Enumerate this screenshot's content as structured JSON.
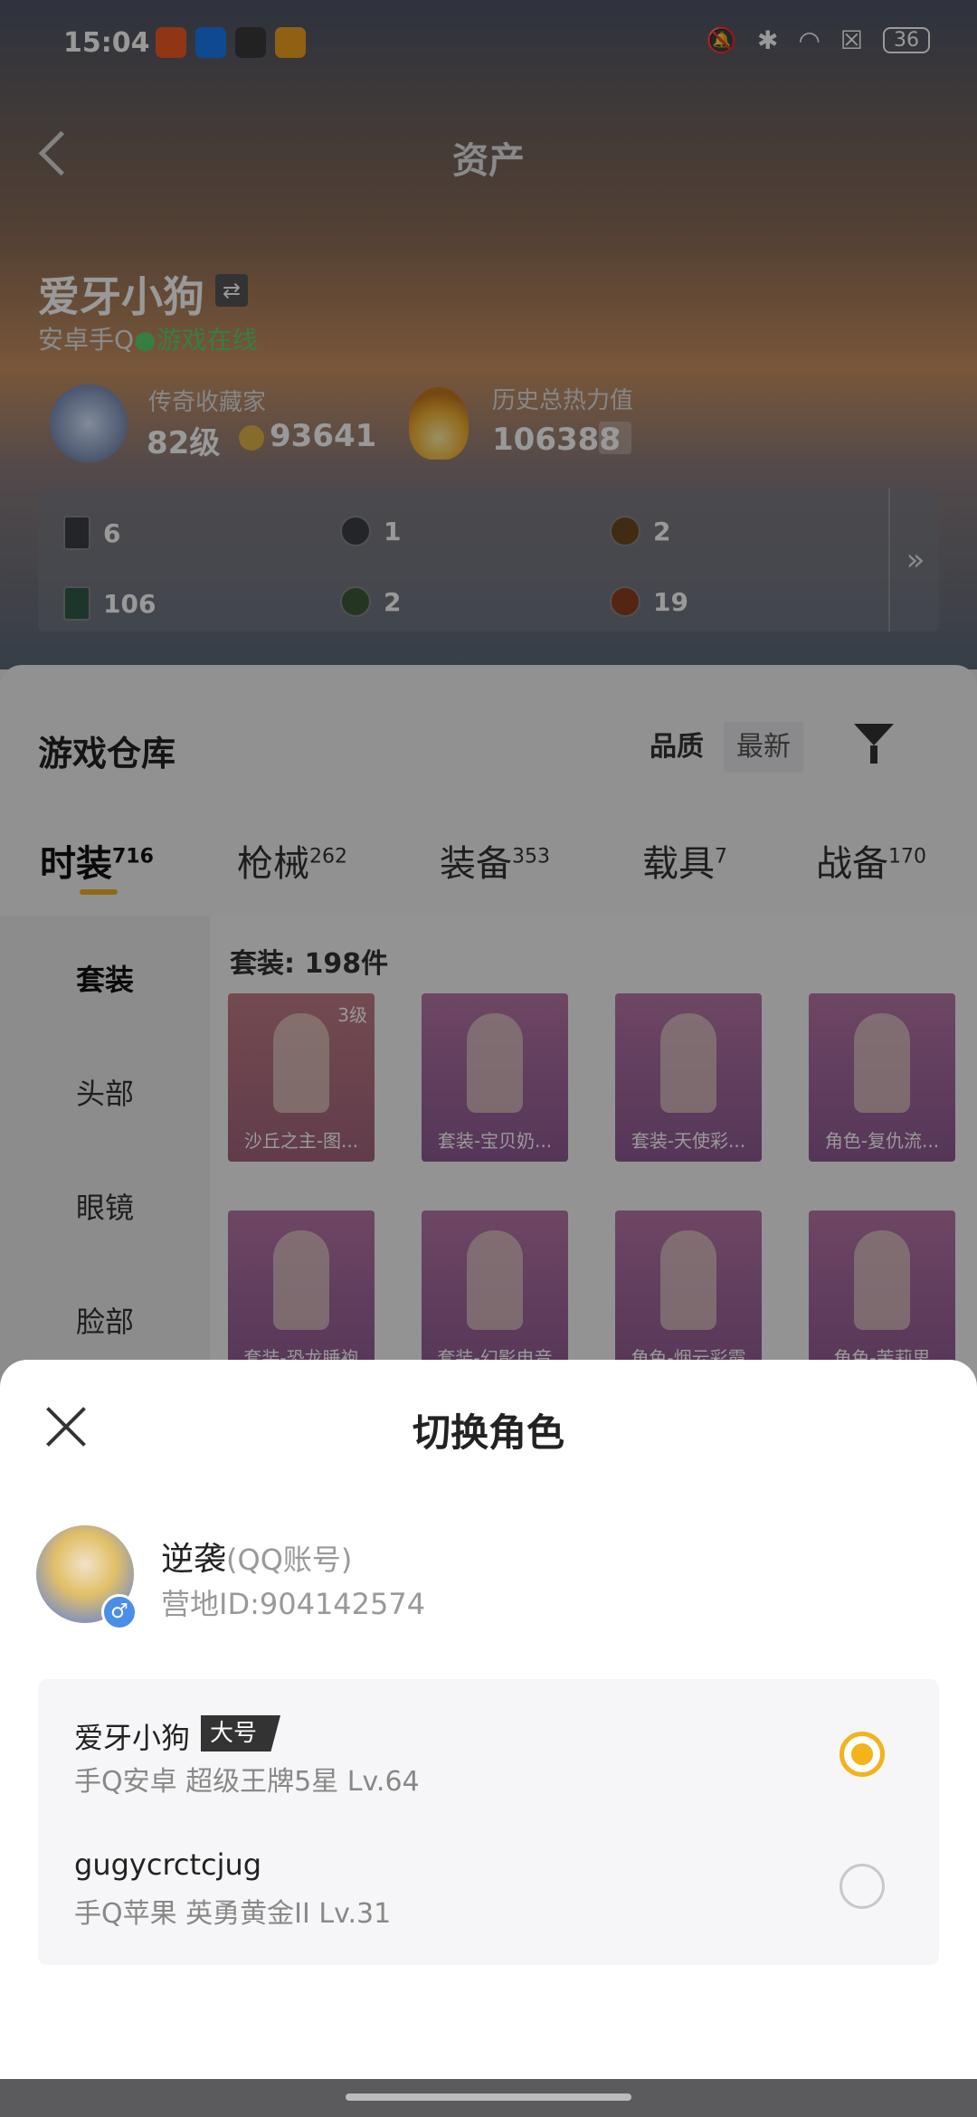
{
  "status_bar": {
    "time": "15:04",
    "battery": "36"
  },
  "header": {
    "title": "资产"
  },
  "player": {
    "name": "爱牙小狗",
    "platform": "安卓手Q",
    "online_status": "●游戏在线",
    "rank_label": "传奇收藏家",
    "rank_level": "82级",
    "coins": "93641",
    "heat_label": "历史总热力值",
    "heat_value": "106388",
    "help": "?"
  },
  "stats": {
    "items": [
      {
        "value": "6"
      },
      {
        "value": "1"
      },
      {
        "value": "2"
      },
      {
        "value": "106"
      },
      {
        "value": "2"
      },
      {
        "value": "19"
      }
    ],
    "more": "»"
  },
  "warehouse": {
    "title": "游戏仓库",
    "sort_quality": "品质",
    "sort_latest": "最新",
    "tabs": [
      {
        "label": "时装",
        "count": "716"
      },
      {
        "label": "枪械",
        "count": "262"
      },
      {
        "label": "装备",
        "count": "353"
      },
      {
        "label": "载具",
        "count": "7"
      },
      {
        "label": "战备",
        "count": "170"
      }
    ],
    "side": [
      "套装",
      "头部",
      "眼镜",
      "脸部"
    ],
    "count_text": "套装: 198件",
    "items": [
      {
        "name": "沙丘之主-图...",
        "level": "3级"
      },
      {
        "name": "套装-宝贝奶...",
        "level": ""
      },
      {
        "name": "套装-天使彩...",
        "level": ""
      },
      {
        "name": "角色-复仇流...",
        "level": ""
      },
      {
        "name": "套装-恐龙睡袍",
        "level": ""
      },
      {
        "name": "套装-幻影电音",
        "level": ""
      },
      {
        "name": "角色-烟云彩霞",
        "level": ""
      },
      {
        "name": "角色-茉莉思",
        "level": ""
      }
    ]
  },
  "sheet": {
    "title": "切换角色",
    "account": {
      "name": "逆袭",
      "type": "(QQ账号)",
      "id": "营地ID:904142574",
      "gender": "♂"
    },
    "roles": [
      {
        "name": "爱牙小狗",
        "tag": "大号",
        "detail": "手Q安卓  超级王牌5星  Lv.64",
        "selected": true
      },
      {
        "name": "gugycrctcjug",
        "tag": "",
        "detail": "手Q苹果  英勇黄金II  Lv.31",
        "selected": false
      }
    ]
  },
  "colors": {
    "accent": "#f4b21b",
    "online": "#5bd36e"
  }
}
